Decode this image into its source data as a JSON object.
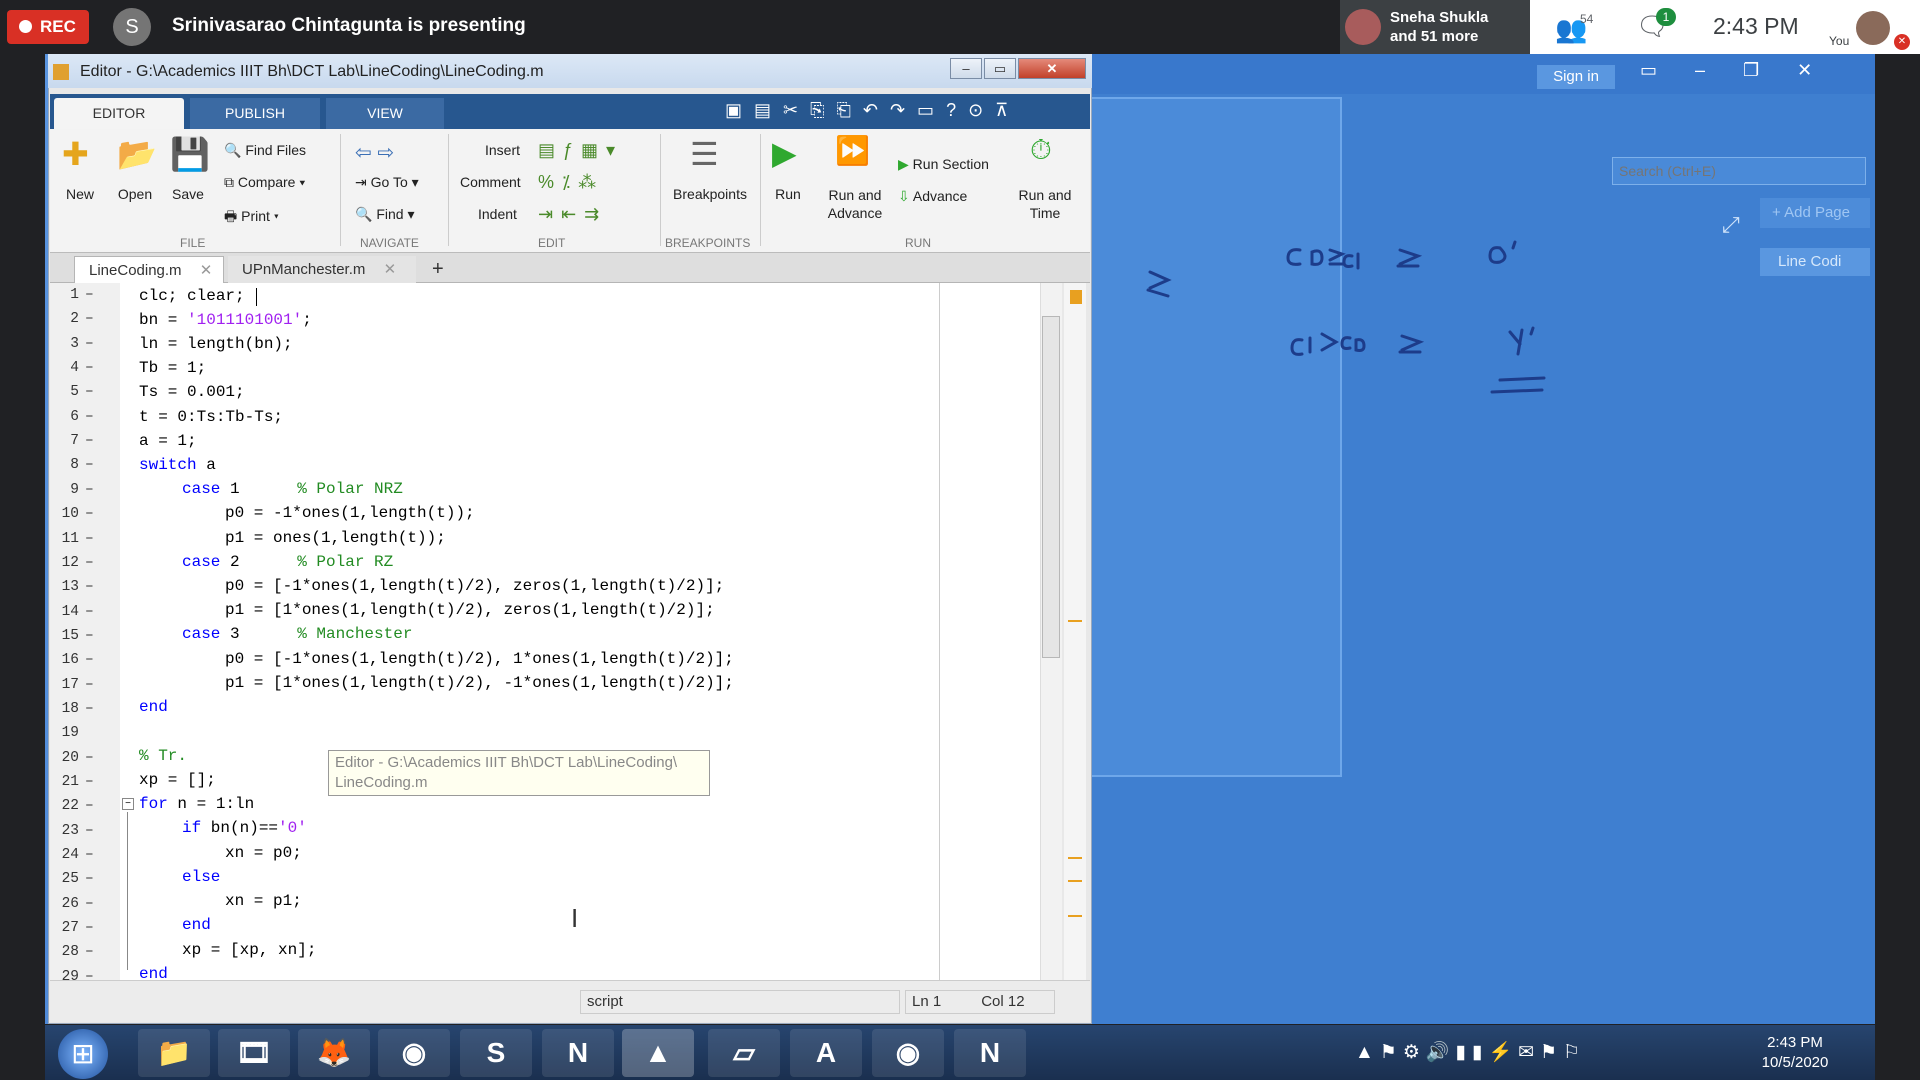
{
  "meet": {
    "rec_label": "REC",
    "presenter_initial": "S",
    "presenter_text": "Srinivasarao Chintagunta is presenting",
    "participant_name": "Sneha Shukla",
    "participant_more": "and 51 more",
    "people_count": "54",
    "chat_badge": "1",
    "time": "2:43 PM",
    "you_label": "You"
  },
  "editor": {
    "title": "Editor - G:\\Academics IIIT Bh\\DCT Lab\\LineCoding\\LineCoding.m",
    "tabs": [
      "EDITOR",
      "PUBLISH",
      "VIEW"
    ],
    "file_group": {
      "label": "FILE",
      "new": "New",
      "open": "Open",
      "save": "Save",
      "find_files": "Find Files",
      "compare": "Compare",
      "print": "Print"
    },
    "navigate_group": {
      "label": "NAVIGATE",
      "goto": "Go To",
      "find": "Find"
    },
    "edit_group": {
      "label": "EDIT",
      "insert": "Insert",
      "comment": "Comment",
      "indent": "Indent"
    },
    "breakpoints_group": {
      "label": "BREAKPOINTS",
      "breakpoints": "Breakpoints"
    },
    "run_group": {
      "label": "RUN",
      "run": "Run",
      "run_and_advance_1": "Run and",
      "run_and_advance_2": "Advance",
      "run_section": "Run Section",
      "advance": "Advance",
      "run_and_time_1": "Run and",
      "run_and_time_2": "Time"
    },
    "doc_tabs": [
      "LineCoding.m",
      "UPnManchester.m"
    ],
    "line_numbers": [
      "1",
      "2",
      "3",
      "4",
      "5",
      "6",
      "7",
      "8",
      "9",
      "10",
      "11",
      "12",
      "13",
      "14",
      "15",
      "16",
      "17",
      "18",
      "19",
      "20",
      "21",
      "22",
      "23",
      "24",
      "25",
      "26",
      "27",
      "28",
      "29"
    ],
    "code": {
      "l1": "clc; clear;",
      "l2a": "bn = ",
      "l2b": "'1011101001'",
      "l2c": ";",
      "l3": "ln = length(bn);",
      "l4": "Tb = 1;",
      "l5": "Ts = 0.001;",
      "l6": "t = 0:Ts:Tb-Ts;",
      "l7": "a = 1;",
      "l8a": "switch",
      "l8b": " a",
      "l9a": "case",
      "l9b": " 1      ",
      "l9c": "% Polar NRZ",
      "l10": "p0 = -1*ones(1,length(t));",
      "l11": "p1 = ones(1,length(t));",
      "l12a": "case",
      "l12b": " 2      ",
      "l12c": "% Polar RZ",
      "l13": "p0 = [-1*ones(1,length(t)/2), zeros(1,length(t)/2)];",
      "l14": "p1 = [1*ones(1,length(t)/2), zeros(1,length(t)/2)];",
      "l15a": "case",
      "l15b": " 3      ",
      "l15c": "% Manchester",
      "l16": "p0 = [-1*ones(1,length(t)/2), 1*ones(1,length(t)/2)];",
      "l17": "p1 = [1*ones(1,length(t)/2), -1*ones(1,length(t)/2)];",
      "l18": "end",
      "l20": "% Tr.",
      "l21": "xp = [];",
      "l22a": "for",
      "l22b": " n = 1:ln",
      "l23a": "if",
      "l23b": " bn(n)==",
      "l23c": "'0'",
      "l24": "xn = p0;",
      "l25": "else",
      "l26": "xn = p1;",
      "l27": "end",
      "l28": "xp = [xp, xn];",
      "l29": "end"
    },
    "tooltip_1": "Editor - G:\\Academics IIIT Bh\\DCT Lab\\LineCoding\\",
    "tooltip_2": "LineCoding.m",
    "status_script": "script",
    "status_ln": "Ln  1",
    "status_col": "Col  12"
  },
  "onenote": {
    "signin": "Sign in",
    "search_placeholder": "Search (Ctrl+E)",
    "add_page": "+ Add Page",
    "page_tab": "Line Codi"
  },
  "taskbar": {
    "time": "2:43 PM",
    "date": "10/5/2020"
  }
}
